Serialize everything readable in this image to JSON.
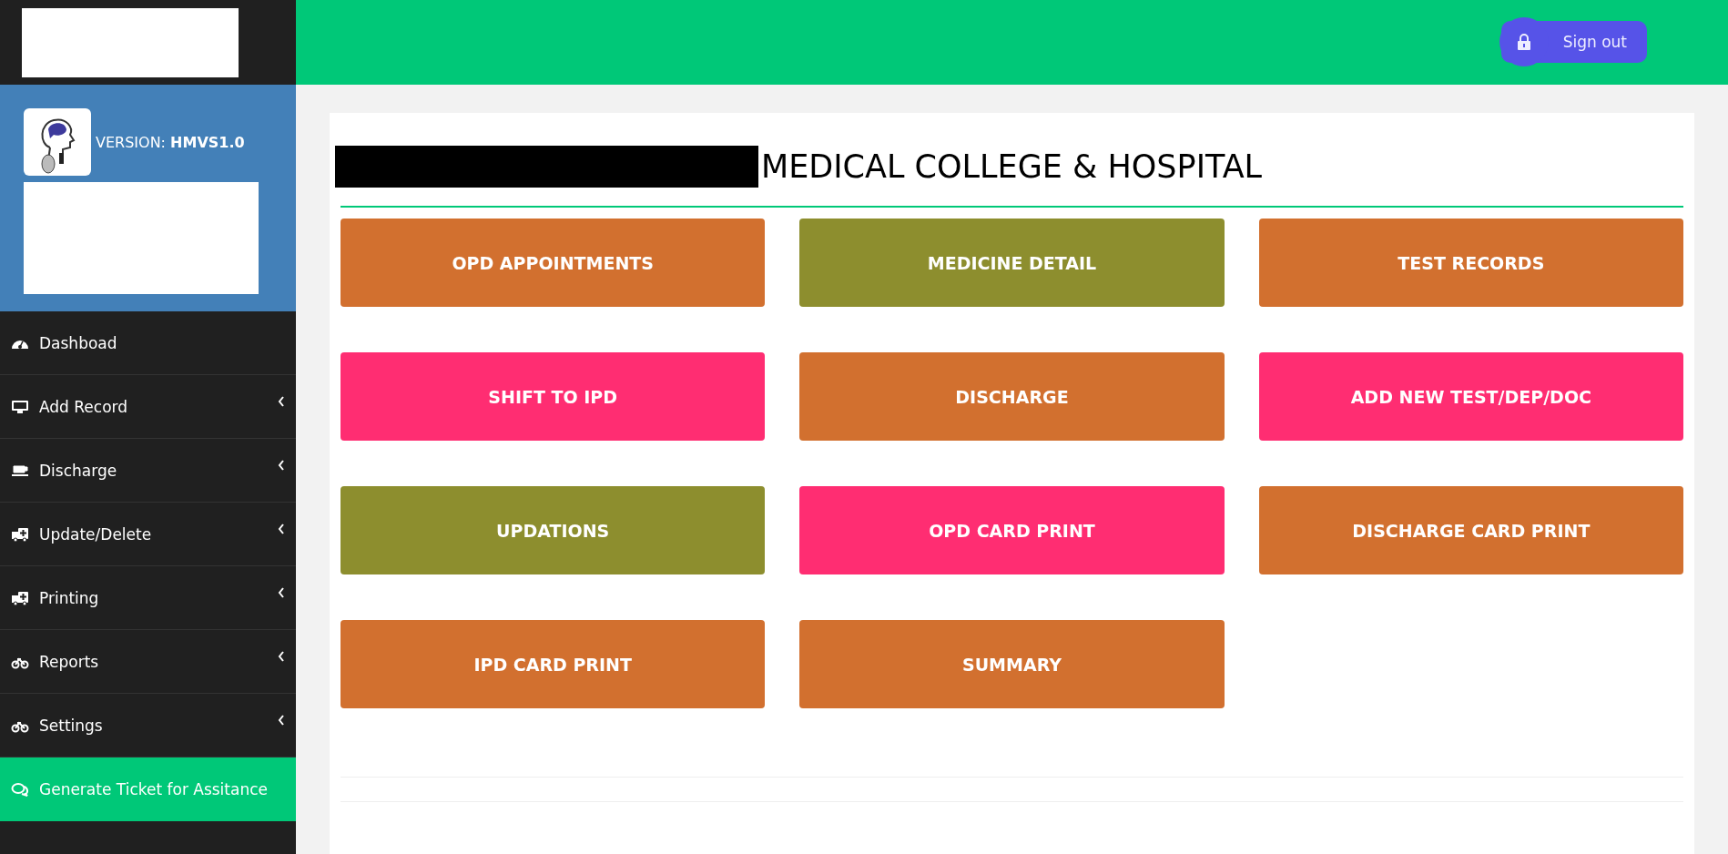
{
  "sidebar": {
    "version_label": "VERSION:",
    "version_value": "HMVS1.0",
    "items": [
      {
        "label": "Dashboad",
        "has_submenu": false
      },
      {
        "label": "Add Record",
        "has_submenu": true
      },
      {
        "label": "Discharge",
        "has_submenu": true
      },
      {
        "label": "Update/Delete",
        "has_submenu": true
      },
      {
        "label": "Printing",
        "has_submenu": true
      },
      {
        "label": "Reports",
        "has_submenu": true
      },
      {
        "label": "Settings",
        "has_submenu": true
      }
    ],
    "ticket_link": "Generate Ticket for Assitance"
  },
  "header": {
    "sign_out": "Sign out"
  },
  "title": "MEDICAL COLLEGE & HOSPITAL",
  "tiles": [
    {
      "label": "OPD APPOINTMENTS",
      "color": "#d2702f"
    },
    {
      "label": "MEDICINE DETAIL",
      "color": "#8d8e2e"
    },
    {
      "label": "TEST RECORDS",
      "color": "#d2702f"
    },
    {
      "label": "SHIFT TO IPD",
      "color": "#ff2d72"
    },
    {
      "label": "DISCHARGE",
      "color": "#d2702f"
    },
    {
      "label": "ADD NEW TEST/DEP/DOC",
      "color": "#ff2d72"
    },
    {
      "label": "UPDATIONS",
      "color": "#8d8e2e"
    },
    {
      "label": "OPD CARD PRINT",
      "color": "#ff2d72"
    },
    {
      "label": "DISCHARGE CARD PRINT",
      "color": "#d2702f"
    },
    {
      "label": "IPD CARD PRINT",
      "color": "#d2702f"
    },
    {
      "label": "SUMMARY",
      "color": "#d2702f"
    }
  ]
}
